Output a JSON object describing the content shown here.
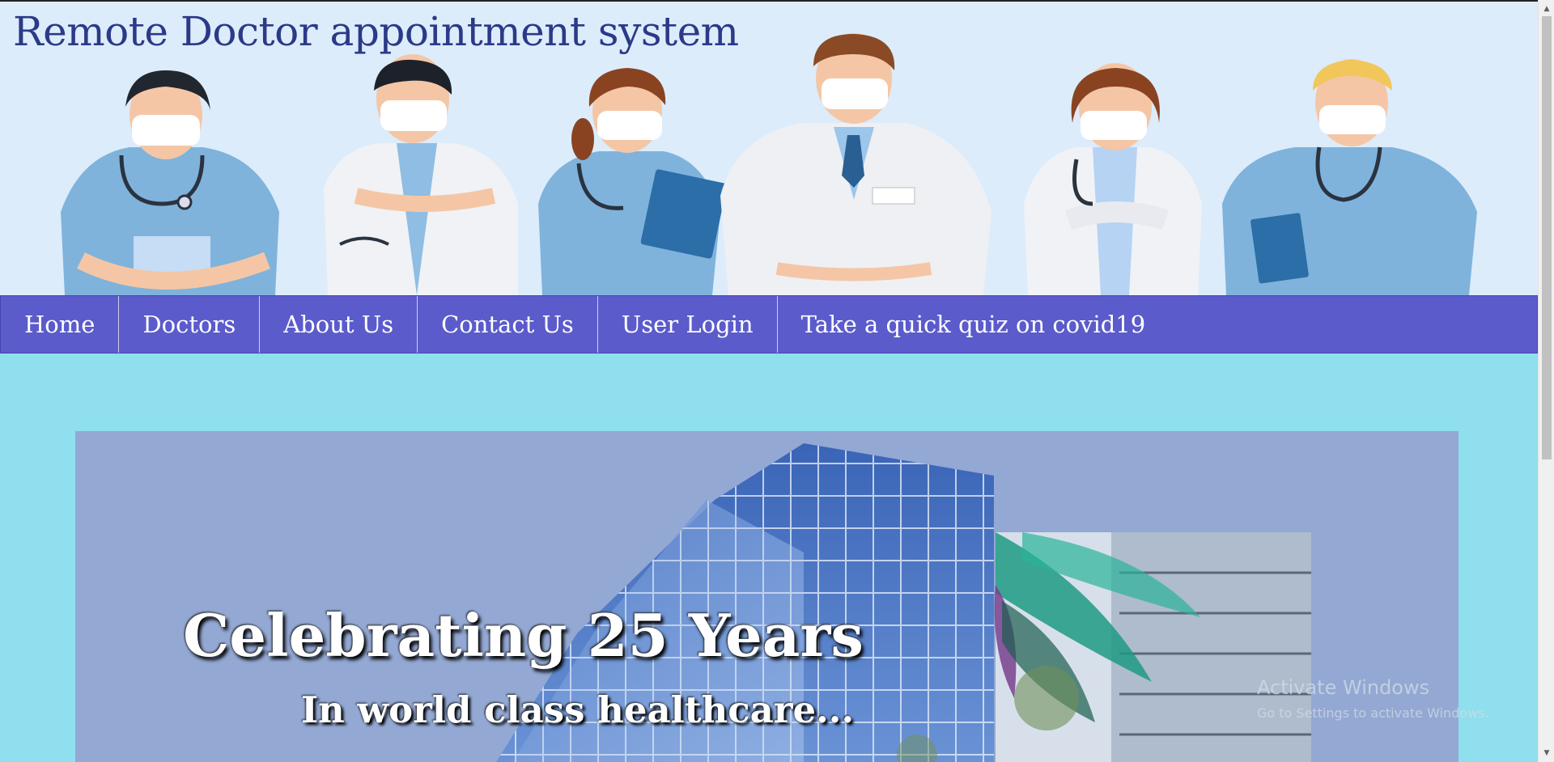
{
  "header": {
    "title": "Remote Doctor appointment system"
  },
  "nav": {
    "items": [
      {
        "label": "Home"
      },
      {
        "label": "Doctors"
      },
      {
        "label": "About Us"
      },
      {
        "label": "Contact Us"
      },
      {
        "label": "User Login"
      },
      {
        "label": "Take a quick quiz on covid19"
      }
    ]
  },
  "banner": {
    "title": "Celebrating 25 Years",
    "subtitle": "In world class healthcare..."
  },
  "watermark": {
    "title": "Activate Windows",
    "subtitle": "Go to Settings to activate Windows."
  },
  "colors": {
    "header_bg": "#dcecfb",
    "title": "#2b3a87",
    "nav_bg": "#5b5bcb",
    "page_bg": "#8fdfee",
    "banner_bg": "#93a8d3"
  }
}
